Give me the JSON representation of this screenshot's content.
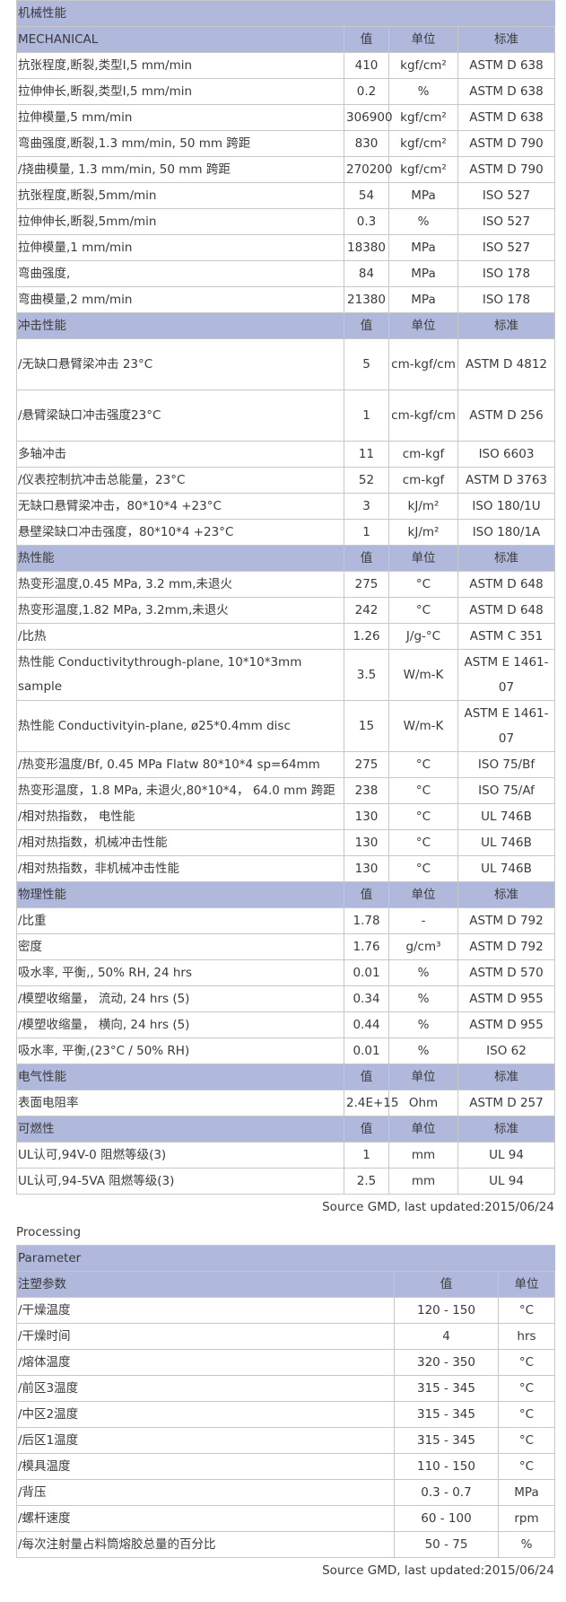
{
  "props": {
    "title": "机械性能",
    "header": {
      "name": "MECHANICAL",
      "value": "值",
      "unit": "单位",
      "standard": "标准"
    },
    "mechanical": [
      [
        "抗张程度,断裂,类型I,5 mm/min",
        "410",
        "kgf/cm²",
        "ASTM D 638"
      ],
      [
        "拉伸伸长,断裂,类型I,5 mm/min",
        "0.2",
        "%",
        "ASTM D 638"
      ],
      [
        "拉伸模量,5 mm/min",
        "306900",
        "kgf/cm²",
        "ASTM D 638"
      ],
      [
        "弯曲强度,断裂,1.3 mm/min, 50 mm 跨距",
        "830",
        "kgf/cm²",
        "ASTM D 790"
      ],
      [
        "/挠曲模量, 1.3 mm/min, 50 mm 跨距",
        "270200",
        "kgf/cm²",
        "ASTM D 790"
      ],
      [
        "抗张程度,断裂,5mm/min",
        "54",
        "MPa",
        "ISO 527"
      ],
      [
        "拉伸伸长,断裂,5mm/min",
        "0.3",
        "%",
        "ISO 527"
      ],
      [
        "拉伸模量,1 mm/min",
        "18380",
        "MPa",
        "ISO 527"
      ],
      [
        "弯曲强度,",
        "84",
        "MPa",
        "ISO 178"
      ],
      [
        "弯曲模量,2 mm/min",
        "21380",
        "MPa",
        "ISO 178"
      ]
    ],
    "impact_header": {
      "name": "冲击性能",
      "value": "值",
      "unit": "单位",
      "standard": "标准"
    },
    "impact_tall": [
      [
        "/无缺口悬臂梁冲击 23°C",
        "5",
        "cm-kgf/cm",
        "ASTM D 4812"
      ],
      [
        "/悬臂梁缺口冲击强度23°C",
        "1",
        "cm-kgf/cm",
        "ASTM D 256"
      ]
    ],
    "impact": [
      [
        "多轴冲击",
        "11",
        "cm-kgf",
        "ISO 6603"
      ],
      [
        "/仪表控制抗冲击总能量，23°C",
        "52",
        "cm-kgf",
        "ASTM D 3763"
      ],
      [
        "无缺口悬臂梁冲击，80*10*4 +23°C",
        "3",
        "kJ/m²",
        "ISO 180/1U"
      ],
      [
        "悬壁梁缺口冲击强度，80*10*4 +23°C",
        "1",
        "kJ/m²",
        "ISO 180/1A"
      ]
    ],
    "thermal_header": {
      "name": "热性能",
      "value": "值",
      "unit": "单位",
      "standard": "标准"
    },
    "thermal_a": [
      [
        "热变形温度,0.45 MPa, 3.2 mm,未退火",
        "275",
        "°C",
        "ASTM D 648"
      ],
      [
        "热变形温度,1.82 MPa, 3.2mm,未退火",
        "242",
        "°C",
        "ASTM D 648"
      ],
      [
        "/比热",
        "1.26",
        "J/g-°C",
        "ASTM C 351"
      ]
    ],
    "thermal_tall": [
      [
        "热性能 Conductivitythrough-plane, 10*10*3mm sample",
        "3.5",
        "W/m-K",
        "ASTM E 1461-07"
      ],
      [
        "热性能 Conductivityin-plane, ø25*0.4mm disc",
        "15",
        "W/m-K",
        "ASTM E 1461-07"
      ]
    ],
    "thermal_b": [
      [
        "/热变形温度/Bf, 0.45 MPa Flatw 80*10*4 sp=64mm",
        "275",
        "°C",
        "ISO 75/Bf"
      ],
      [
        "热变形温度，1.8 MPa, 未退火,80*10*4， 64.0 mm 跨距",
        "238",
        "°C",
        "ISO 75/Af"
      ],
      [
        "/相对热指数， 电性能",
        "130",
        "°C",
        "UL 746B"
      ],
      [
        "/相对热指数，机械冲击性能",
        "130",
        "°C",
        "UL 746B"
      ],
      [
        "/相对热指数，非机械冲击性能",
        "130",
        "°C",
        "UL 746B"
      ]
    ],
    "physical_header": {
      "name": "物理性能",
      "value": "值",
      "unit": "单位",
      "standard": "标准"
    },
    "physical": [
      [
        "/比重",
        "1.78",
        "-",
        "ASTM D 792"
      ],
      [
        "密度",
        "1.76",
        "g/cm³",
        "ASTM D 792"
      ],
      [
        "吸水率, 平衡,, 50% RH, 24 hrs",
        "0.01",
        "%",
        "ASTM D 570"
      ],
      [
        "/模塑收缩量， 流动, 24 hrs (5)",
        "0.34",
        "%",
        "ASTM D 955"
      ],
      [
        "/模塑收缩量， 横向, 24 hrs (5)",
        "0.44",
        "%",
        "ASTM D 955"
      ],
      [
        "吸水率, 平衡,(23°C / 50% RH)",
        "0.01",
        "%",
        "ISO 62"
      ]
    ],
    "electrical_header": {
      "name": "电气性能",
      "value": "值",
      "unit": "单位",
      "standard": "标准"
    },
    "electrical": [
      [
        "表面电阻率",
        "2.4E+15",
        "Ohm",
        "ASTM D 257"
      ]
    ],
    "flammability_header": {
      "name": "可燃性",
      "value": "值",
      "unit": "单位",
      "standard": "标准"
    },
    "flammability": [
      [
        "UL认可,94V-0 阻燃等级(3)",
        "1",
        "mm",
        "UL 94"
      ],
      [
        "UL认可,94-5VA 阻燃等级(3)",
        "2.5",
        "mm",
        "UL 94"
      ]
    ],
    "source": "Source GMD, last updated:2015/06/24"
  },
  "processing": {
    "title": "Processing",
    "section": "Parameter",
    "header": {
      "name": "注塑参数",
      "value": "值",
      "unit": "单位"
    },
    "rows": [
      [
        "/干燥温度",
        "120 - 150",
        "°C"
      ],
      [
        "/干燥时间",
        "4",
        "hrs"
      ],
      [
        "/熔体温度",
        "320 - 350",
        "°C"
      ],
      [
        "/前区3温度",
        "315 - 345",
        "°C"
      ],
      [
        "/中区2温度",
        "315 - 345",
        "°C"
      ],
      [
        "/后区1温度",
        "315 - 345",
        "°C"
      ],
      [
        "/模具温度",
        "110 - 150",
        "°C"
      ],
      [
        "/背压",
        "0.3 - 0.7",
        "MPa"
      ],
      [
        "/螺杆速度",
        "60 - 100",
        "rpm"
      ],
      [
        "/每次注射量占料筒熔胶总量的百分比",
        "50 - 75",
        "%"
      ]
    ],
    "source": "Source GMD, last updated:2015/06/24"
  }
}
